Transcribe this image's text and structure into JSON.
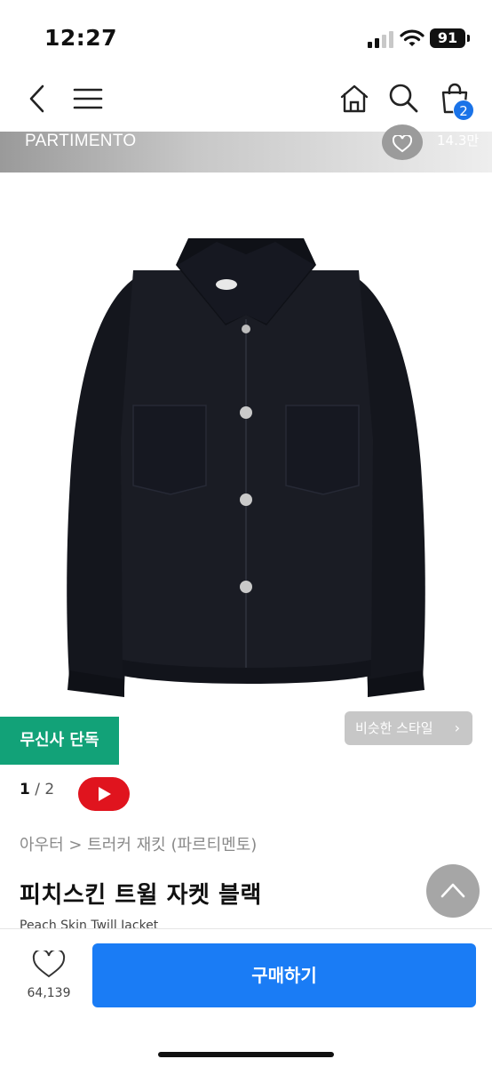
{
  "status_bar": {
    "time": "12:27",
    "battery": "91"
  },
  "header": {
    "cart_count": "2"
  },
  "brand": {
    "name": "PARTIMENTO",
    "like_count": "14.3만"
  },
  "gallery": {
    "exclusive_badge": "무신사 단독",
    "similar_style": "비슷한 스타일",
    "current_page": "1",
    "total_pages": "2"
  },
  "product": {
    "breadcrumb": "아우터 > 트러커 재킷 (파르티멘토)",
    "title": "피치스킨 트윌 자켓 블랙",
    "subtitle": "Peach Skin Twill Jacket"
  },
  "bottom": {
    "like_count": "64,139",
    "buy_label": "구매하기"
  },
  "colors": {
    "accent": "#1a7cf5",
    "exclusive": "#12a278",
    "video": "#e0141e",
    "badge": "#1a73e8"
  }
}
